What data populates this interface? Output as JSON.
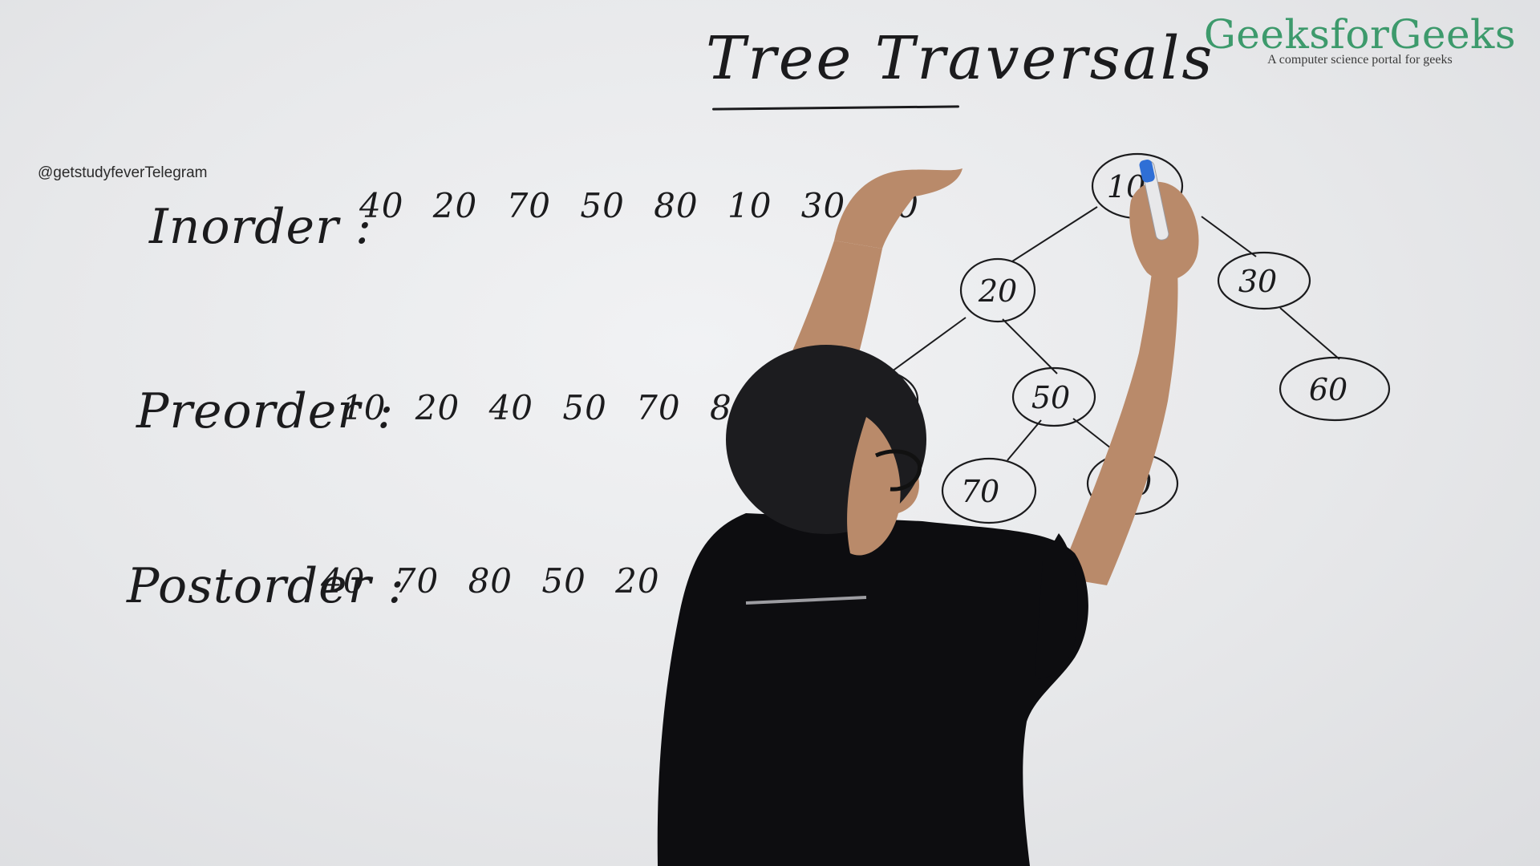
{
  "title": "Tree Traversals",
  "watermark": "@getstudyfeverTelegram",
  "logo": {
    "name": "GeeksforGeeks",
    "tagline": "A computer science portal for geeks"
  },
  "traversals": [
    {
      "label": "Inorder :",
      "sequence": "40 20 70 50 80 10 30 60"
    },
    {
      "label": "Preorder :",
      "sequence": "10 20 40 50 70 80 30 60"
    },
    {
      "label": "Postorder :",
      "sequence": "40 70 80 50 20 60 30"
    }
  ],
  "tree": {
    "nodes": [
      {
        "id": "n10",
        "value": "10"
      },
      {
        "id": "n20",
        "value": "20"
      },
      {
        "id": "n30",
        "value": "30"
      },
      {
        "id": "n40",
        "value": "40"
      },
      {
        "id": "n50",
        "value": "50"
      },
      {
        "id": "n60",
        "value": "60"
      },
      {
        "id": "n70",
        "value": "70"
      },
      {
        "id": "n80",
        "value": "80"
      }
    ]
  },
  "colors": {
    "ink": "#1b1b1d",
    "brand": "#3d9a6c",
    "marker_cap": "#2f6fd6",
    "shirt": "#0d0d10",
    "skin": "#b98a6a",
    "hair": "#1c1c1f"
  }
}
